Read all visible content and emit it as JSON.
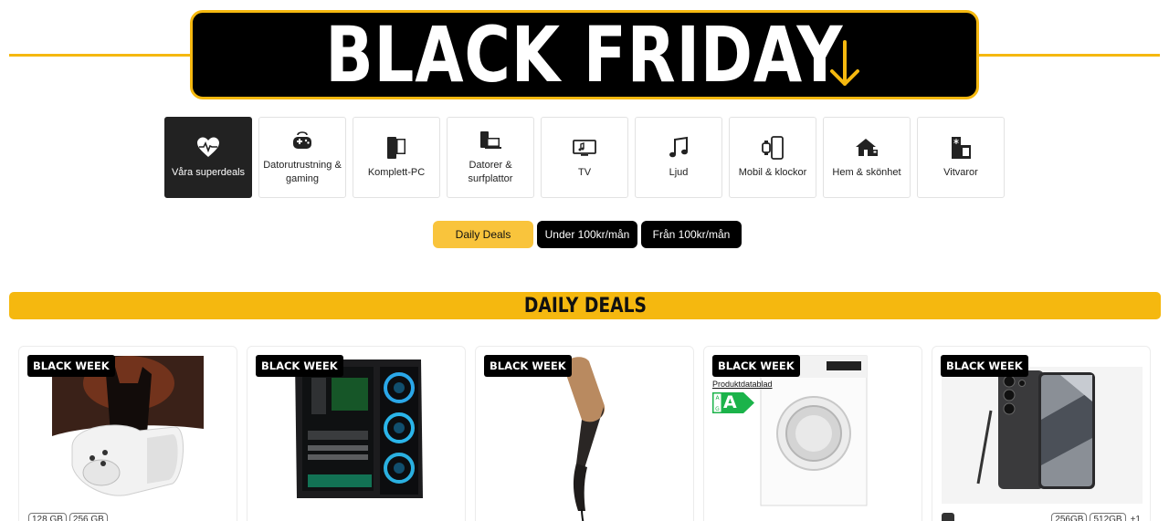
{
  "banner": {
    "title": "BLACK FRIDAY",
    "accent": "#f5b80f"
  },
  "categories": [
    {
      "label": "Våra superdeals",
      "icon": "heart-pulse-icon",
      "active": true
    },
    {
      "label": "Datorutrustning & gaming",
      "icon": "gamepad-icon"
    },
    {
      "label": "Komplett-PC",
      "icon": "pc-tower-icon"
    },
    {
      "label": "Datorer & surfplattor",
      "icon": "laptop-icon"
    },
    {
      "label": "TV",
      "icon": "tv-icon"
    },
    {
      "label": "Ljud",
      "icon": "music-note-icon"
    },
    {
      "label": "Mobil & klockor",
      "icon": "phone-watch-icon"
    },
    {
      "label": "Hem & skönhet",
      "icon": "home-icon"
    },
    {
      "label": "Vitvaror",
      "icon": "fridge-icon"
    }
  ],
  "tabs": [
    {
      "label": "Daily Deals",
      "active": true
    },
    {
      "label": "Under 100kr/mån"
    },
    {
      "label": "Från 100kr/mån"
    }
  ],
  "section": {
    "title": "DAILY DEALS"
  },
  "products": [
    {
      "badge": "BLACK WEEK",
      "kind": "vr-headset",
      "chips": [
        "128 GB",
        "256 GB"
      ]
    },
    {
      "badge": "BLACK WEEK",
      "kind": "gaming-pc",
      "chips": []
    },
    {
      "badge": "BLACK WEEK",
      "kind": "steamer",
      "chips": []
    },
    {
      "badge": "BLACK WEEK",
      "kind": "washing-machine",
      "chips": [],
      "link": "Produktdatablad",
      "energy_class": "A",
      "energy_scale": "A-G"
    },
    {
      "badge": "BLACK WEEK",
      "kind": "smartphone",
      "chips": [
        "256GB",
        "512GB"
      ],
      "more": "+1"
    }
  ]
}
